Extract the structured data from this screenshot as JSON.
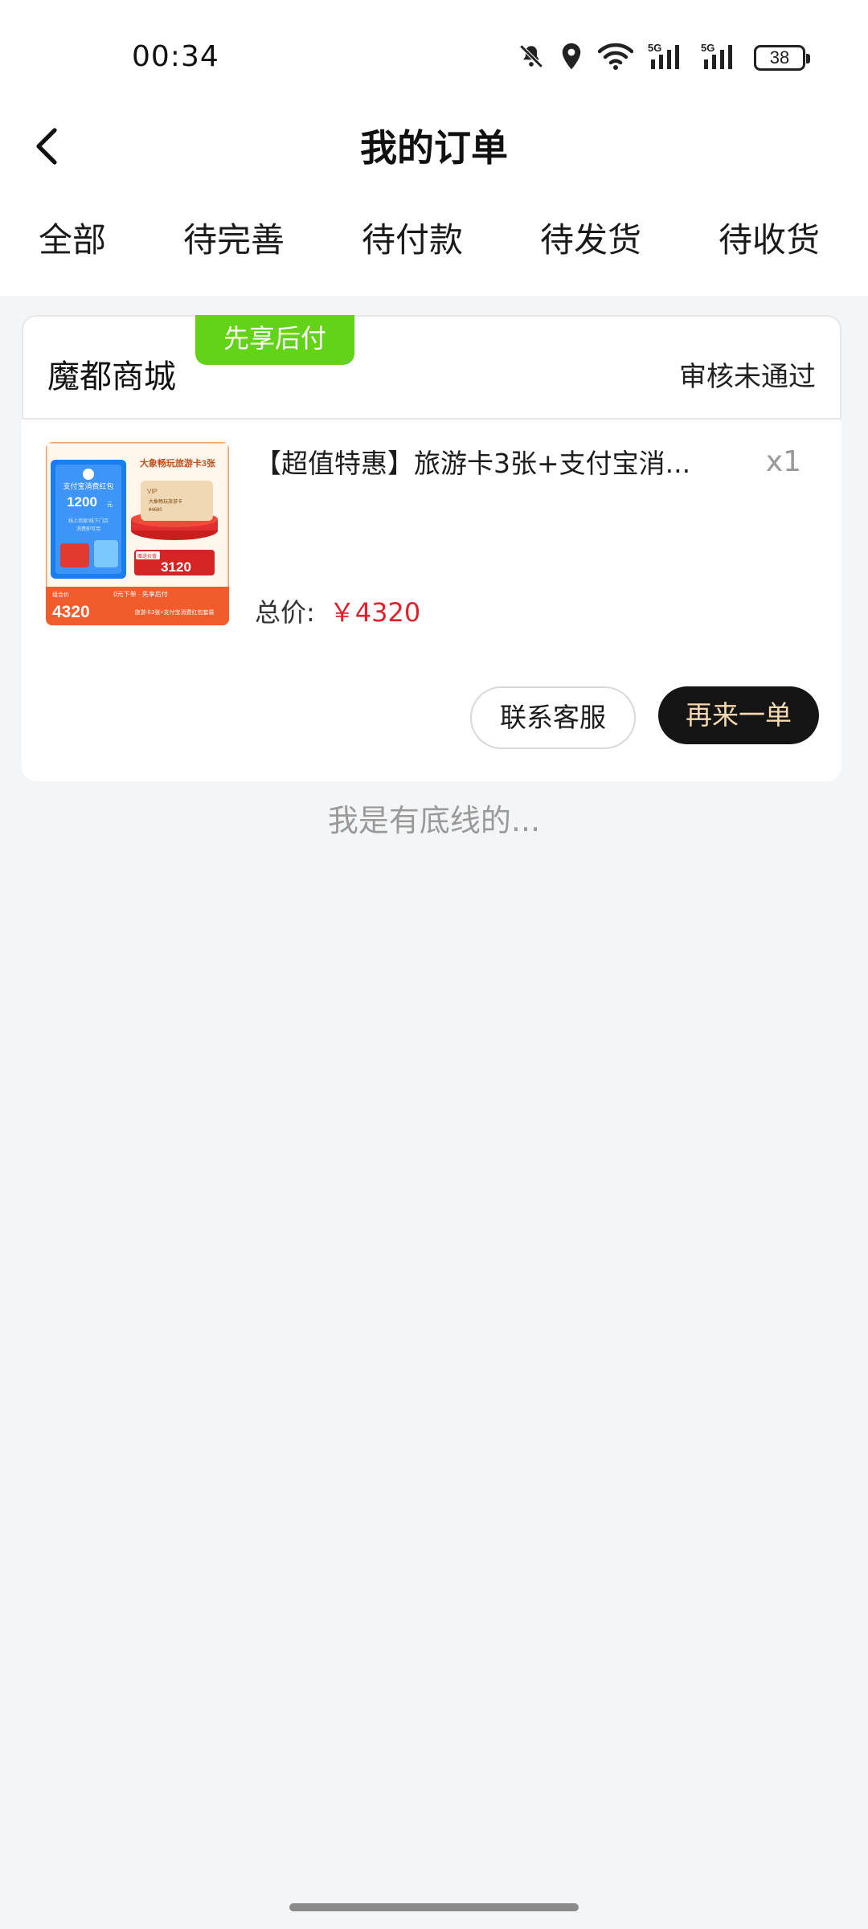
{
  "status_bar": {
    "time": "00:34",
    "battery_level": "38",
    "icons": [
      "bell-off-icon",
      "location-icon",
      "wifi-icon",
      "signal-5g-icon",
      "signal-5g-icon",
      "battery-icon"
    ]
  },
  "header": {
    "title": "我的订单",
    "back_icon": "chevron-left-icon"
  },
  "tabs": [
    {
      "label": "全部"
    },
    {
      "label": "待完善"
    },
    {
      "label": "待付款"
    },
    {
      "label": "待发货"
    },
    {
      "label": "待收货"
    }
  ],
  "order": {
    "shop_name": "魔都商城",
    "badge": "先享后付",
    "status": "审核未通过",
    "product": {
      "title": "【超值特惠】旅游卡3张+支付宝消...",
      "quantity": "x1",
      "image": {
        "headline": "大象畅玩旅游卡3张",
        "left_card_title": "支付宝消费红包",
        "left_card_amount": "1200",
        "left_card_unit": "元",
        "left_card_note1": "线上商家/线下门店",
        "left_card_note2": "消费即可用",
        "vip_card_label": "VIP",
        "vip_card_text": "大象畅玩旅游卡",
        "vip_card_price": "¥4680",
        "gift_price_label": "赠送价值",
        "gift_price_value": "3120",
        "promo_tag": "0元下单 · 先享后付",
        "bottom_price_label": "组合价",
        "bottom_price": "4320",
        "bottom_desc": "旅游卡3张+支付宝消费红包套装"
      }
    },
    "total_label": "总价:",
    "total_price": "￥4320",
    "buttons": {
      "service": "联系客服",
      "reorder": "再来一单"
    }
  },
  "footer_text": "我是有底线的...",
  "colors": {
    "badge_green": "#63d31a",
    "price_red": "#e0202a",
    "reorder_bg": "#151515",
    "reorder_text": "#f5d9b0",
    "page_bg": "#f4f5f7"
  }
}
